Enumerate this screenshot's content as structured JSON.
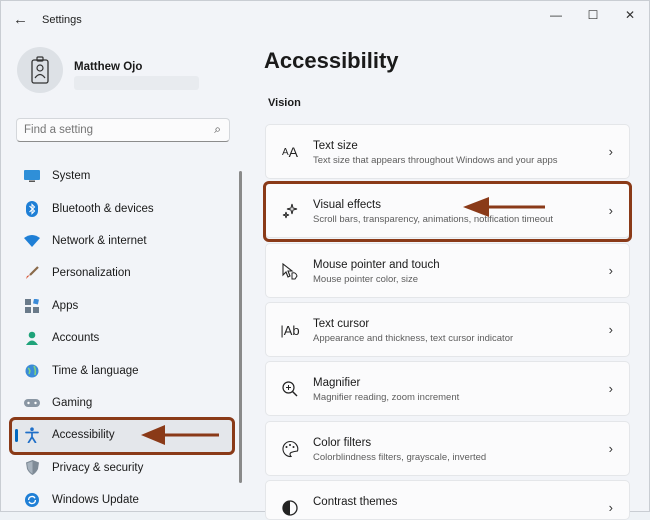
{
  "titlebar": {
    "back_glyph": "←",
    "title": "Settings",
    "minimize": "—",
    "maximize": "☐",
    "close": "✕"
  },
  "profile": {
    "name": "Matthew Ojo"
  },
  "search": {
    "placeholder": "Find a setting"
  },
  "nav": [
    {
      "label": "System",
      "icon": "system-icon"
    },
    {
      "label": "Bluetooth & devices",
      "icon": "bluetooth-icon"
    },
    {
      "label": "Network & internet",
      "icon": "network-icon"
    },
    {
      "label": "Personalization",
      "icon": "brush-icon"
    },
    {
      "label": "Apps",
      "icon": "apps-icon"
    },
    {
      "label": "Accounts",
      "icon": "accounts-icon"
    },
    {
      "label": "Time & language",
      "icon": "globe-icon"
    },
    {
      "label": "Gaming",
      "icon": "gamepad-icon"
    },
    {
      "label": "Accessibility",
      "icon": "accessibility-icon",
      "active": true
    },
    {
      "label": "Privacy & security",
      "icon": "shield-icon"
    },
    {
      "label": "Windows Update",
      "icon": "update-icon"
    }
  ],
  "main": {
    "title": "Accessibility",
    "section": "Vision",
    "cards": [
      {
        "title": "Text size",
        "desc": "Text size that appears throughout Windows and your apps",
        "icon": "text-size-icon"
      },
      {
        "title": "Visual effects",
        "desc": "Scroll bars, transparency, animations, notification timeout",
        "icon": "sparkle-icon"
      },
      {
        "title": "Mouse pointer and touch",
        "desc": "Mouse pointer color, size",
        "icon": "pointer-icon"
      },
      {
        "title": "Text cursor",
        "desc": "Appearance and thickness, text cursor indicator",
        "icon": "text-cursor-icon"
      },
      {
        "title": "Magnifier",
        "desc": "Magnifier reading, zoom increment",
        "icon": "magnifier-icon"
      },
      {
        "title": "Color filters",
        "desc": "Colorblindness filters, grayscale, inverted",
        "icon": "palette-icon"
      },
      {
        "title": "Contrast themes",
        "desc": "",
        "icon": "contrast-icon"
      }
    ]
  },
  "colors": {
    "accent": "#0067c0",
    "annotation": "#8a3a18"
  }
}
